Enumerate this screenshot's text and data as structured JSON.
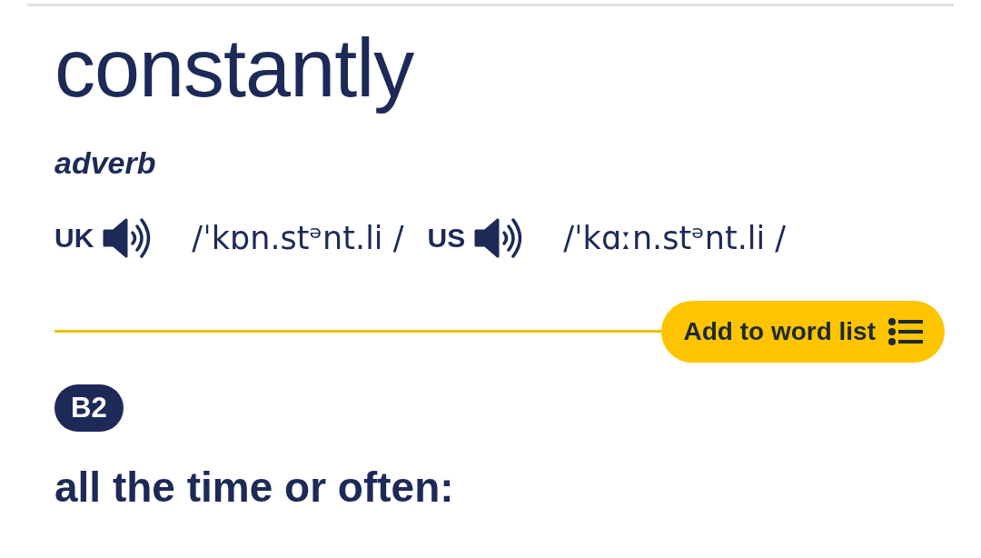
{
  "headword": "constantly",
  "part_of_speech": "adverb",
  "pronunciations": [
    {
      "region": "UK",
      "ipa": "/ˈkɒn.stᵊnt.li /"
    },
    {
      "region": "US",
      "ipa": "/ˈkɑːn.stᵊnt.li /"
    }
  ],
  "word_list_button": {
    "label": "Add to word list"
  },
  "level_badge": "B2",
  "definition": "all the time or often:"
}
